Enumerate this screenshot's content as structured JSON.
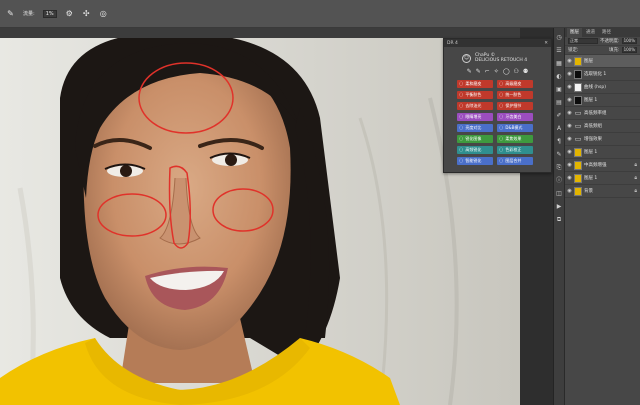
{
  "options_bar": {
    "icons": [
      "brush-icon",
      "settings-icon",
      "airbrush-icon",
      "tablet-pressure-icon"
    ],
    "flow_label": "流量:",
    "flow_value": "1%"
  },
  "plugin_panel": {
    "header": "DR 4",
    "brand_line1": "ChaPu ©",
    "brand_line2": "DELICIOUS RETOUCH 4",
    "tool_icons": [
      "✎",
      "✎",
      "⌐",
      "✧",
      "◯",
      "⚇",
      "⚉"
    ],
    "buttons": [
      {
        "label": "柔和磨皮",
        "color": "#c0392b"
      },
      {
        "label": "高级磨皮",
        "color": "#c0392b"
      },
      {
        "label": "平衡肤色",
        "color": "#c0392b"
      },
      {
        "label": "统一肤色",
        "color": "#c0392b"
      },
      {
        "label": "去除油光",
        "color": "#c0392b"
      },
      {
        "label": "保护细节",
        "color": "#c0392b"
      },
      {
        "label": "眼睛增亮",
        "color": "#9b4dbf"
      },
      {
        "label": "牙齿美白",
        "color": "#9b4dbf"
      },
      {
        "label": "亮度对比",
        "color": "#4a6fc9"
      },
      {
        "label": "D&B模式",
        "color": "#4a6fc9"
      },
      {
        "label": "锐化图像",
        "color": "#3e9a3e"
      },
      {
        "label": "柔焦效果",
        "color": "#3e9a3e"
      },
      {
        "label": "高频锐化",
        "color": "#2f8f8f"
      },
      {
        "label": "色彩校正",
        "color": "#2f8f8f"
      },
      {
        "label": "智能锐化",
        "color": "#4a6fc9"
      },
      {
        "label": "图层合并",
        "color": "#4a6fc9"
      }
    ]
  },
  "layers_panel": {
    "tabs": [
      "图层",
      "通道",
      "路径"
    ],
    "active_tab": 0,
    "blend_mode": "正常",
    "opacity_label": "不透明度:",
    "opacity_value": "100%",
    "lock_label": "锁定:",
    "fill_label": "填充:",
    "fill_value": "100%",
    "layers": [
      {
        "name": "图层",
        "thumb": "photo",
        "selected": true,
        "lock": false
      },
      {
        "name": "选取锐化 1",
        "thumb": "black",
        "selected": false,
        "lock": false
      },
      {
        "name": "曲线 (hsp)",
        "thumb": "white",
        "selected": false,
        "lock": false
      },
      {
        "name": "图层 1",
        "thumb": "black",
        "selected": false,
        "lock": false
      },
      {
        "name": "高低频率组",
        "thumb": "folder",
        "selected": false,
        "lock": false
      },
      {
        "name": "高低频组",
        "thumb": "folder",
        "selected": false,
        "lock": false
      },
      {
        "name": "增强效果",
        "thumb": "folder",
        "selected": false,
        "lock": false
      },
      {
        "name": "图层 1",
        "thumb": "photo",
        "selected": false,
        "lock": false
      },
      {
        "name": "中高频增强",
        "thumb": "photo",
        "selected": false,
        "lock": true
      },
      {
        "name": "图层 1",
        "thumb": "photo",
        "selected": false,
        "lock": true
      },
      {
        "name": "背景",
        "thumb": "photo",
        "selected": false,
        "lock": true
      }
    ]
  },
  "right_toolbar_icons": [
    "history-icon",
    "properties-icon",
    "swatches-icon",
    "adjustments-icon",
    "styles-icon",
    "channels-icon",
    "paths-icon",
    "text-icon",
    "paragraph-icon",
    "brush-settings-icon",
    "clone-source-icon",
    "info-icon",
    "navigator-icon",
    "actions-icon",
    "layer-comps-icon"
  ],
  "colors": {
    "annotation_red": "#e0322a",
    "shirt_yellow": "#f2c200",
    "panel_bg": "#474747"
  }
}
